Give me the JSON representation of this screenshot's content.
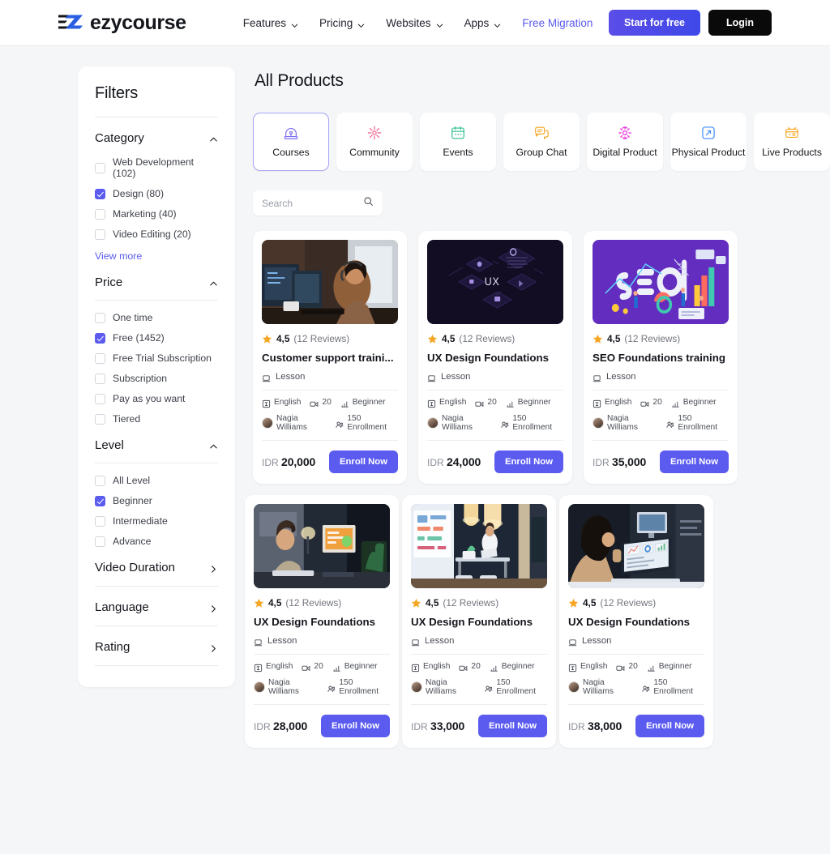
{
  "brand": {
    "name": "ezycourse",
    "logo_icon": "ez-logo-icon"
  },
  "nav": {
    "items": [
      {
        "label": "Features",
        "has_dropdown": true,
        "accent": false
      },
      {
        "label": "Pricing",
        "has_dropdown": true,
        "accent": false
      },
      {
        "label": "Websites",
        "has_dropdown": true,
        "accent": false
      },
      {
        "label": "Apps",
        "has_dropdown": true,
        "accent": false
      },
      {
        "label": "Free Migration",
        "has_dropdown": false,
        "accent": true
      }
    ],
    "start_label": "Start for free",
    "login_label": "Login"
  },
  "colors": {
    "accent": "#5b5bf0",
    "accent_gradient_from": "#5b4de8",
    "accent_gradient_to": "#3f49e8",
    "login_bg": "#0a0a0a",
    "page_bg": "#f5f6f8",
    "star": "#f5a623",
    "text": "#14161c",
    "muted": "#73757f"
  },
  "sidebar": {
    "title": "Filters",
    "sections": [
      {
        "title": "Category",
        "collapsible": true,
        "expanded": true,
        "options": [
          {
            "label": "Web Development (102)",
            "checked": false
          },
          {
            "label": "Design (80)",
            "checked": true
          },
          {
            "label": "Marketing (40)",
            "checked": false
          },
          {
            "label": "Video Editing (20)",
            "checked": false
          }
        ],
        "view_more": "View more"
      },
      {
        "title": "Price",
        "collapsible": true,
        "expanded": true,
        "options": [
          {
            "label": "One time",
            "checked": false
          },
          {
            "label": "Free (1452)",
            "checked": true
          },
          {
            "label": "Free Trial Subscription",
            "checked": false
          },
          {
            "label": "Subscription",
            "checked": false
          },
          {
            "label": "Pay as you want",
            "checked": false
          },
          {
            "label": "Tiered",
            "checked": false
          }
        ]
      },
      {
        "title": "Level",
        "collapsible": true,
        "expanded": true,
        "options": [
          {
            "label": "All Level",
            "checked": false
          },
          {
            "label": "Beginner",
            "checked": true
          },
          {
            "label": "Intermediate",
            "checked": false
          },
          {
            "label": "Advance",
            "checked": false
          }
        ]
      }
    ],
    "collapsed_sections": [
      {
        "title": "Video Duration"
      },
      {
        "title": "Language"
      },
      {
        "title": "Rating"
      }
    ]
  },
  "main": {
    "page_title": "All Products",
    "search": {
      "placeholder": "Search",
      "value": "",
      "icon": "search-icon"
    },
    "tabs": [
      {
        "label": "Courses",
        "icon": "graduation-cap-icon",
        "color": "#7c6cf0",
        "active": true
      },
      {
        "label": "Community",
        "icon": "community-flower-icon",
        "color": "#f2608d",
        "active": false
      },
      {
        "label": "Events",
        "icon": "calendar-icon",
        "color": "#2bbf8a",
        "active": false
      },
      {
        "label": "Group Chat",
        "icon": "chat-bubbles-icon",
        "color": "#f5a623",
        "active": false
      },
      {
        "label": "Digital Product",
        "icon": "digital-product-icon",
        "color": "#e522d8",
        "active": false
      },
      {
        "label": "Physical Product",
        "icon": "physical-product-icon",
        "color": "#3d8bfd",
        "active": false
      },
      {
        "label": "Live Products",
        "icon": "live-products-icon",
        "color": "#f5a623",
        "active": false
      }
    ],
    "labels": {
      "lesson": "Lesson",
      "currency": "IDR",
      "enroll": "Enroll Now",
      "reviews_suffix": "Reviews"
    },
    "products": [
      {
        "thumb": "customer-support-photo",
        "rating": "4,5",
        "reviews": "(12 Reviews)",
        "title": "Customer support traini...",
        "type": "Lesson",
        "language": "English",
        "videos": "20",
        "level": "Beginner",
        "instructor": "Nagia Williams",
        "enrollment": "150 Enrollment",
        "currency": "IDR",
        "price": "20,000",
        "cta": "Enroll Now"
      },
      {
        "thumb": "ux-isometric-art",
        "rating": "4,5",
        "reviews": "(12 Reviews)",
        "title": "UX Design Foundations",
        "type": "Lesson",
        "language": "English",
        "videos": "20",
        "level": "Beginner",
        "instructor": "Nagia Williams",
        "enrollment": "150 Enrollment",
        "currency": "IDR",
        "price": "24,000",
        "cta": "Enroll Now"
      },
      {
        "thumb": "seo-isometric-art",
        "rating": "4,5",
        "reviews": "(12 Reviews)",
        "title": "SEO Foundations training",
        "type": "Lesson",
        "language": "English",
        "videos": "20",
        "level": "Beginner",
        "instructor": "Nagia Williams",
        "enrollment": "150 Enrollment",
        "currency": "IDR",
        "price": "35,000",
        "cta": "Enroll Now"
      },
      {
        "thumb": "office-desk-night-photo",
        "rating": "4,5",
        "reviews": "(12 Reviews)",
        "title": "UX Design Foundations",
        "type": "Lesson",
        "language": "English",
        "videos": "20",
        "level": "Beginner",
        "instructor": "Nagia Williams",
        "enrollment": "150 Enrollment",
        "currency": "IDR",
        "price": "28,000",
        "cta": "Enroll Now"
      },
      {
        "thumb": "office-meeting-night-photo",
        "rating": "4,5",
        "reviews": "(12 Reviews)",
        "title": "UX Design Foundations",
        "type": "Lesson",
        "language": "English",
        "videos": "20",
        "level": "Beginner",
        "instructor": "Nagia Williams",
        "enrollment": "150 Enrollment",
        "currency": "IDR",
        "price": "33,000",
        "cta": "Enroll Now"
      },
      {
        "thumb": "laptop-analytics-photo",
        "rating": "4,5",
        "reviews": "(12 Reviews)",
        "title": "UX Design Foundations",
        "type": "Lesson",
        "language": "English",
        "videos": "20",
        "level": "Beginner",
        "instructor": "Nagia Williams",
        "enrollment": "150 Enrollment",
        "currency": "IDR",
        "price": "38,000",
        "cta": "Enroll Now"
      }
    ]
  }
}
